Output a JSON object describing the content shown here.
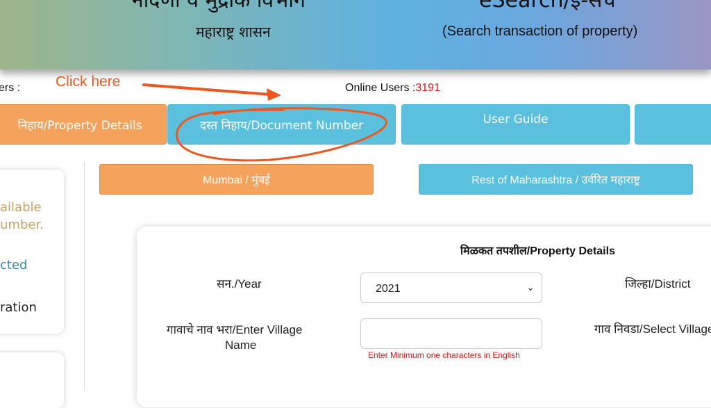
{
  "header": {
    "department": "नोंदणी व मुद्रांक विभाग",
    "government": "महाराष्ट्र शासन",
    "service": "eSearch/ई-सर्च",
    "tagline": "(Search transaction of property)"
  },
  "status": {
    "users_label": "ers :",
    "online_label": "Online Users :",
    "online_count": "3191"
  },
  "annotation": {
    "click_here": "Click here"
  },
  "nav": {
    "property_details": "निहाय/Property Details",
    "document_number": "दस्त निहाय/Document Number",
    "user_guide": "User Guide"
  },
  "sidebar": {
    "line1": "ailable",
    "line2": "umber.",
    "line3": "cted",
    "line4": "ration"
  },
  "regions": {
    "mumbai": "Mumbai / मुंबई",
    "rest": "Rest of Maharashtra / उर्वरित महाराष्ट्र"
  },
  "form": {
    "title": "मिळकत तपशील/Property Details",
    "year_label": "सन./Year",
    "year_value": "2021",
    "district_label": "जिल्हा/District",
    "village_label_line1": "गावाचे नाव भरा/Enter Village",
    "village_label_line2": "Name",
    "village_placeholder": "",
    "village_hint": "Enter Minimum one characters in English",
    "select_village_label": "गाव निवडा/Select Village"
  },
  "colors": {
    "orange": "#f4a25c",
    "blue": "#5bc0de",
    "annotation": "#f2561d",
    "count": "#e01010"
  }
}
